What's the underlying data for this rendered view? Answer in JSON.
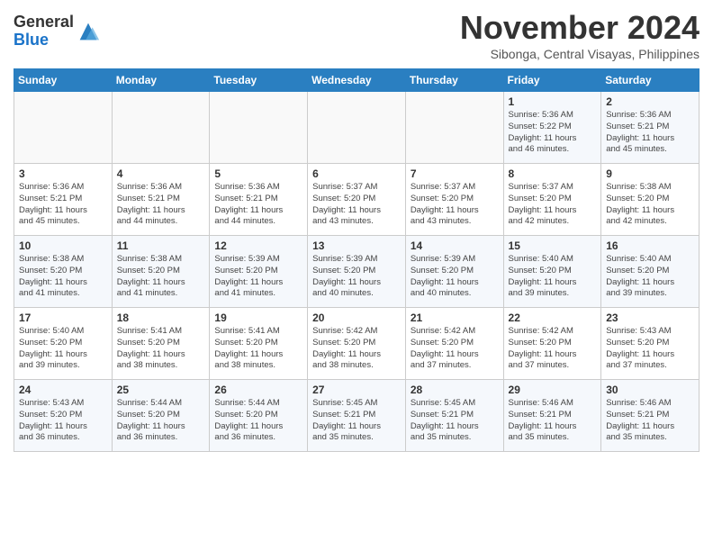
{
  "logo": {
    "text_general": "General",
    "text_blue": "Blue"
  },
  "header": {
    "month": "November 2024",
    "location": "Sibonga, Central Visayas, Philippines"
  },
  "weekdays": [
    "Sunday",
    "Monday",
    "Tuesday",
    "Wednesday",
    "Thursday",
    "Friday",
    "Saturday"
  ],
  "weeks": [
    [
      {
        "day": "",
        "info": ""
      },
      {
        "day": "",
        "info": ""
      },
      {
        "day": "",
        "info": ""
      },
      {
        "day": "",
        "info": ""
      },
      {
        "day": "",
        "info": ""
      },
      {
        "day": "1",
        "info": "Sunrise: 5:36 AM\nSunset: 5:22 PM\nDaylight: 11 hours\nand 46 minutes."
      },
      {
        "day": "2",
        "info": "Sunrise: 5:36 AM\nSunset: 5:21 PM\nDaylight: 11 hours\nand 45 minutes."
      }
    ],
    [
      {
        "day": "3",
        "info": "Sunrise: 5:36 AM\nSunset: 5:21 PM\nDaylight: 11 hours\nand 45 minutes."
      },
      {
        "day": "4",
        "info": "Sunrise: 5:36 AM\nSunset: 5:21 PM\nDaylight: 11 hours\nand 44 minutes."
      },
      {
        "day": "5",
        "info": "Sunrise: 5:36 AM\nSunset: 5:21 PM\nDaylight: 11 hours\nand 44 minutes."
      },
      {
        "day": "6",
        "info": "Sunrise: 5:37 AM\nSunset: 5:20 PM\nDaylight: 11 hours\nand 43 minutes."
      },
      {
        "day": "7",
        "info": "Sunrise: 5:37 AM\nSunset: 5:20 PM\nDaylight: 11 hours\nand 43 minutes."
      },
      {
        "day": "8",
        "info": "Sunrise: 5:37 AM\nSunset: 5:20 PM\nDaylight: 11 hours\nand 42 minutes."
      },
      {
        "day": "9",
        "info": "Sunrise: 5:38 AM\nSunset: 5:20 PM\nDaylight: 11 hours\nand 42 minutes."
      }
    ],
    [
      {
        "day": "10",
        "info": "Sunrise: 5:38 AM\nSunset: 5:20 PM\nDaylight: 11 hours\nand 41 minutes."
      },
      {
        "day": "11",
        "info": "Sunrise: 5:38 AM\nSunset: 5:20 PM\nDaylight: 11 hours\nand 41 minutes."
      },
      {
        "day": "12",
        "info": "Sunrise: 5:39 AM\nSunset: 5:20 PM\nDaylight: 11 hours\nand 41 minutes."
      },
      {
        "day": "13",
        "info": "Sunrise: 5:39 AM\nSunset: 5:20 PM\nDaylight: 11 hours\nand 40 minutes."
      },
      {
        "day": "14",
        "info": "Sunrise: 5:39 AM\nSunset: 5:20 PM\nDaylight: 11 hours\nand 40 minutes."
      },
      {
        "day": "15",
        "info": "Sunrise: 5:40 AM\nSunset: 5:20 PM\nDaylight: 11 hours\nand 39 minutes."
      },
      {
        "day": "16",
        "info": "Sunrise: 5:40 AM\nSunset: 5:20 PM\nDaylight: 11 hours\nand 39 minutes."
      }
    ],
    [
      {
        "day": "17",
        "info": "Sunrise: 5:40 AM\nSunset: 5:20 PM\nDaylight: 11 hours\nand 39 minutes."
      },
      {
        "day": "18",
        "info": "Sunrise: 5:41 AM\nSunset: 5:20 PM\nDaylight: 11 hours\nand 38 minutes."
      },
      {
        "day": "19",
        "info": "Sunrise: 5:41 AM\nSunset: 5:20 PM\nDaylight: 11 hours\nand 38 minutes."
      },
      {
        "day": "20",
        "info": "Sunrise: 5:42 AM\nSunset: 5:20 PM\nDaylight: 11 hours\nand 38 minutes."
      },
      {
        "day": "21",
        "info": "Sunrise: 5:42 AM\nSunset: 5:20 PM\nDaylight: 11 hours\nand 37 minutes."
      },
      {
        "day": "22",
        "info": "Sunrise: 5:42 AM\nSunset: 5:20 PM\nDaylight: 11 hours\nand 37 minutes."
      },
      {
        "day": "23",
        "info": "Sunrise: 5:43 AM\nSunset: 5:20 PM\nDaylight: 11 hours\nand 37 minutes."
      }
    ],
    [
      {
        "day": "24",
        "info": "Sunrise: 5:43 AM\nSunset: 5:20 PM\nDaylight: 11 hours\nand 36 minutes."
      },
      {
        "day": "25",
        "info": "Sunrise: 5:44 AM\nSunset: 5:20 PM\nDaylight: 11 hours\nand 36 minutes."
      },
      {
        "day": "26",
        "info": "Sunrise: 5:44 AM\nSunset: 5:20 PM\nDaylight: 11 hours\nand 36 minutes."
      },
      {
        "day": "27",
        "info": "Sunrise: 5:45 AM\nSunset: 5:21 PM\nDaylight: 11 hours\nand 35 minutes."
      },
      {
        "day": "28",
        "info": "Sunrise: 5:45 AM\nSunset: 5:21 PM\nDaylight: 11 hours\nand 35 minutes."
      },
      {
        "day": "29",
        "info": "Sunrise: 5:46 AM\nSunset: 5:21 PM\nDaylight: 11 hours\nand 35 minutes."
      },
      {
        "day": "30",
        "info": "Sunrise: 5:46 AM\nSunset: 5:21 PM\nDaylight: 11 hours\nand 35 minutes."
      }
    ]
  ]
}
